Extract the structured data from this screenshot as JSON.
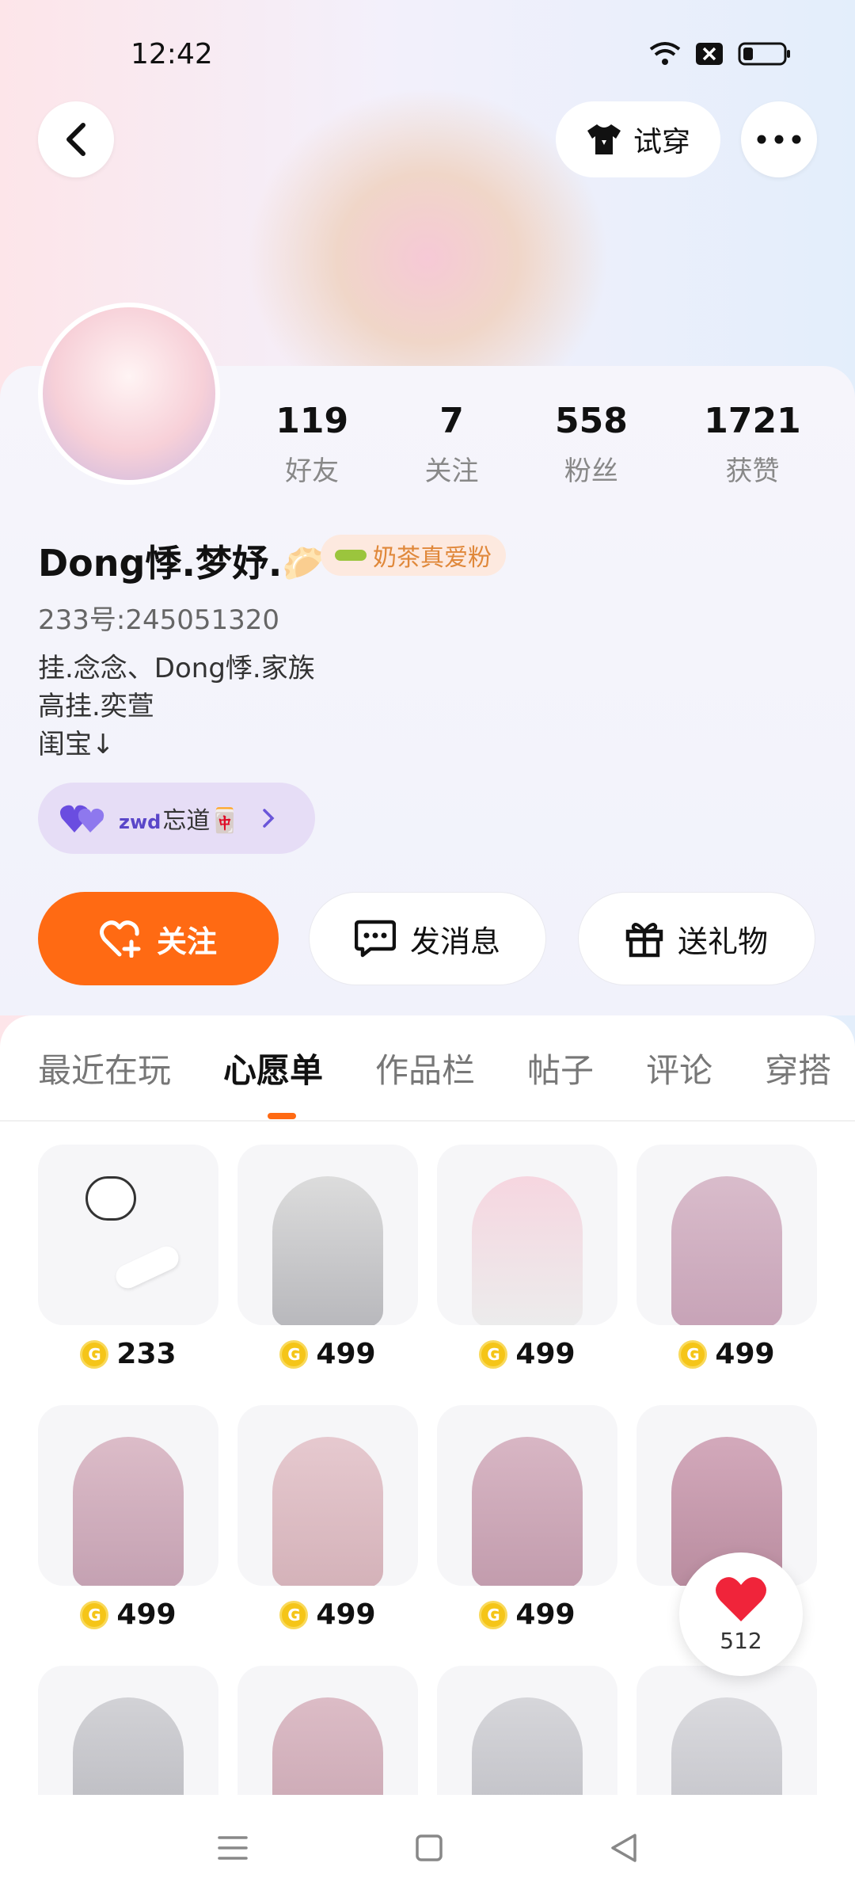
{
  "status_bar": {
    "time": "12:42"
  },
  "header": {
    "try_on_label": "试穿"
  },
  "profile": {
    "stats": [
      {
        "value": "119",
        "label": "好友"
      },
      {
        "value": "7",
        "label": "关注"
      },
      {
        "value": "558",
        "label": "粉丝"
      },
      {
        "value": "1721",
        "label": "获赞"
      }
    ],
    "name": "Dong悸.梦妤.🥟",
    "badge": "奶茶真爱粉",
    "uid": "233号:245051320",
    "bio": [
      "挂.念念、Dong悸.家族",
      "高挂.奕萱",
      "闺宝↓"
    ],
    "group_pill": {
      "prefix": "zwd",
      "text": "忘道🀄"
    }
  },
  "actions": {
    "follow": "关注",
    "message": "发消息",
    "gift": "送礼物"
  },
  "tabs": [
    {
      "label": "最近在玩"
    },
    {
      "label": "心愿单"
    },
    {
      "label": "作品栏"
    },
    {
      "label": "帖子"
    },
    {
      "label": "评论"
    },
    {
      "label": "穿搭"
    }
  ],
  "wishlist": [
    {
      "price": "233"
    },
    {
      "price": "499"
    },
    {
      "price": "499"
    },
    {
      "price": "499"
    },
    {
      "price": "499"
    },
    {
      "price": "499"
    },
    {
      "price": "499"
    },
    {
      "price": ""
    },
    {
      "price": ""
    },
    {
      "price": ""
    },
    {
      "price": ""
    },
    {
      "price": ""
    }
  ],
  "like_float": {
    "count": "512"
  },
  "colors": {
    "accent": "#ff6a13",
    "coin": "#f5c518"
  }
}
